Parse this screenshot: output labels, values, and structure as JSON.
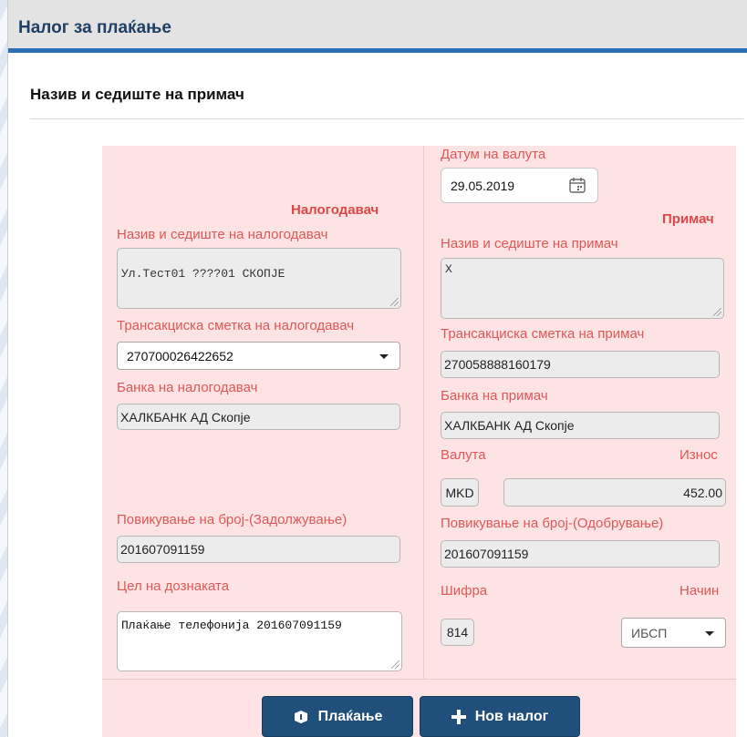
{
  "panel": {
    "title": "Налог за плаќање",
    "section_title": "Назив и седиште на примач"
  },
  "payer": {
    "heading": "Налогодавач",
    "name_label": "Назив и седиште на налогодавач",
    "name_value": "Ул.Тест01 ????01 СКОПЈЕ",
    "account_label": "Трансакциска сметка на налогодавач",
    "account_value": "270700026422652",
    "bank_label": "Банка на налогодавач",
    "bank_value": "ХАЛКБАНК АД Скопје",
    "reference_label": "Повикување на број-(Задолжување)",
    "reference_value": "201607091159",
    "purpose_label": "Цел на дознаката",
    "purpose_value": "Плаќање телефонија 201607091159"
  },
  "payee": {
    "value_date_label": "Датум на валута",
    "value_date": "29.05.2019",
    "heading": "Примач",
    "name_label": "Назив и седиште на примач",
    "name_value": "X",
    "account_label": "Трансакциска сметка на примач",
    "account_value": "270058888160179",
    "bank_label": "Банка на примач",
    "bank_value": "ХАЛКБАНК АД Скопје",
    "currency_label": "Валута",
    "currency_value": "MKD",
    "amount_label": "Износ",
    "amount_value": "452.00",
    "reference_label": "Повикување на број-(Одобрување)",
    "reference_value": "201607091159",
    "code_label": "Шифра",
    "code_value": "814",
    "method_label": "Начин",
    "method_value": "ИБСП"
  },
  "buttons": {
    "pay": "Плаќање",
    "new_order": "Нов налог"
  },
  "colors": {
    "accent": "#2f6db5",
    "label": "#e05858",
    "form_bg": "#fde3e3",
    "button": "#1f4f7a"
  }
}
